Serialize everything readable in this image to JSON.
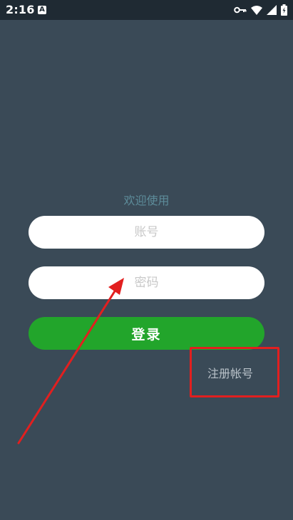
{
  "status_bar": {
    "time": "2:16",
    "notification_icon": "a-icon",
    "icons": [
      "key-icon",
      "wifi-icon",
      "signal-icon",
      "battery-icon"
    ]
  },
  "welcome_text": "欢迎使用",
  "account_field": {
    "placeholder": "账号",
    "value": ""
  },
  "password_field": {
    "placeholder": "密码",
    "value": ""
  },
  "login_button": {
    "label": "登录"
  },
  "register_link": {
    "label": "注册帐号"
  },
  "colors": {
    "background": "#3a4a57",
    "status_bar": "#1f2a33",
    "welcome": "#5d8c9a",
    "login_button": "#22a52b",
    "annotation": "#e21f1f"
  }
}
